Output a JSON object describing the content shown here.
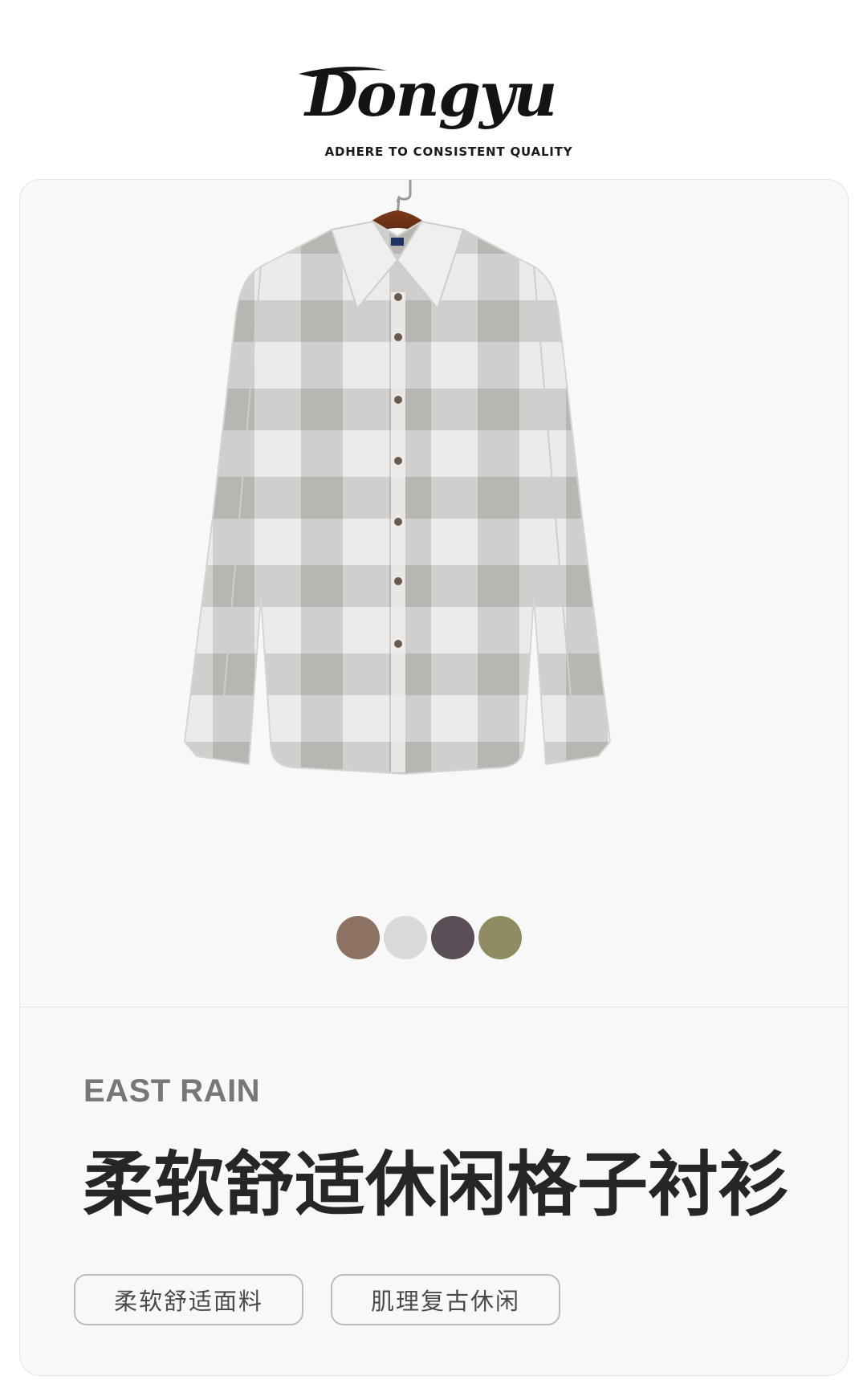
{
  "brand": {
    "logo_text": "Dongyu",
    "tagline": "ADHERE TO CONSISTENT QUALITY"
  },
  "product": {
    "image_subject": "checked-shirt-on-hanger",
    "color_options": [
      {
        "name": "brown",
        "hex": "#8E7263"
      },
      {
        "name": "light-gray",
        "hex": "#D9D9D9"
      },
      {
        "name": "dark-purple-gray",
        "hex": "#5A4E57"
      },
      {
        "name": "olive",
        "hex": "#8E8C62"
      }
    ],
    "series": "EAST RAIN",
    "title": "柔软舒适休闲格子衬衫",
    "tags": [
      "柔软舒适面料",
      "肌理复古休闲"
    ]
  },
  "colors": {
    "card_bg": "#f8f8f8",
    "title_text": "#262626",
    "series_text": "#777777",
    "tag_border": "#bdbdbd"
  }
}
